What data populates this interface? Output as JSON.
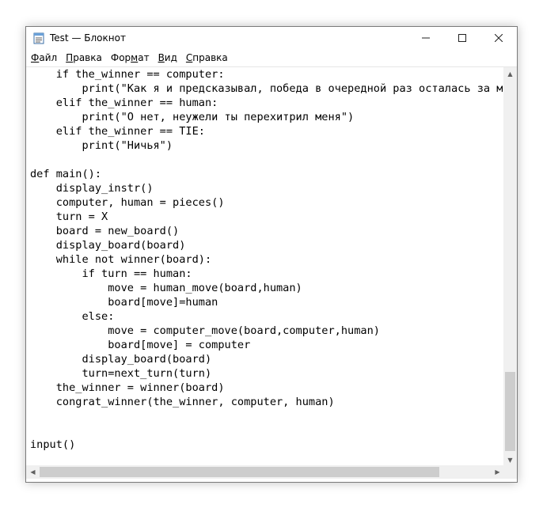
{
  "window": {
    "title": "Test — Блокнот",
    "controls": {
      "minimize": "—",
      "maximize": "☐",
      "close": "✕"
    }
  },
  "menu": [
    {
      "label": "Файл",
      "underline": "Ф",
      "rest": "айл"
    },
    {
      "label": "Правка",
      "underline": "П",
      "rest": "равка"
    },
    {
      "label": "Формат",
      "pre": "Фор",
      "underline": "м",
      "rest": "ат"
    },
    {
      "label": "Вид",
      "underline": "В",
      "rest": "ид"
    },
    {
      "label": "Справка",
      "underline": "С",
      "rest": "правка"
    }
  ],
  "editor": {
    "lines": [
      "    if the_winner == computer:",
      "        print(\"Как я и предсказывал, победа в очередной раз осталась за мно",
      "    elif the_winner == human:",
      "        print(\"О нет, неужели ты перехитрил меня\")",
      "    elif the_winner == TIE:",
      "        print(\"Ничья\")",
      "",
      "def main():",
      "    display_instr()",
      "    computer, human = pieces()",
      "    turn = X",
      "    board = new_board()",
      "    display_board(board)",
      "    while not winner(board):",
      "        if turn == human:",
      "            move = human_move(board,human)",
      "            board[move]=human",
      "        else:",
      "            move = computer_move(board,computer,human)",
      "            board[move] = computer",
      "        display_board(board)",
      "        turn=next_turn(turn)",
      "    the_winner = winner(board)",
      "    congrat_winner(the_winner, computer, human)",
      "",
      "",
      "input()"
    ]
  },
  "colors": {
    "highlight": "#e0191f",
    "scrollbar_track": "#f0f0f0",
    "scrollbar_thumb": "#cdcdcd"
  },
  "icons": {
    "app": "notepad-icon",
    "scroll_up": "arrow-up-icon",
    "scroll_down": "arrow-down-icon",
    "scroll_left": "arrow-left-icon",
    "scroll_right": "arrow-right-icon"
  }
}
